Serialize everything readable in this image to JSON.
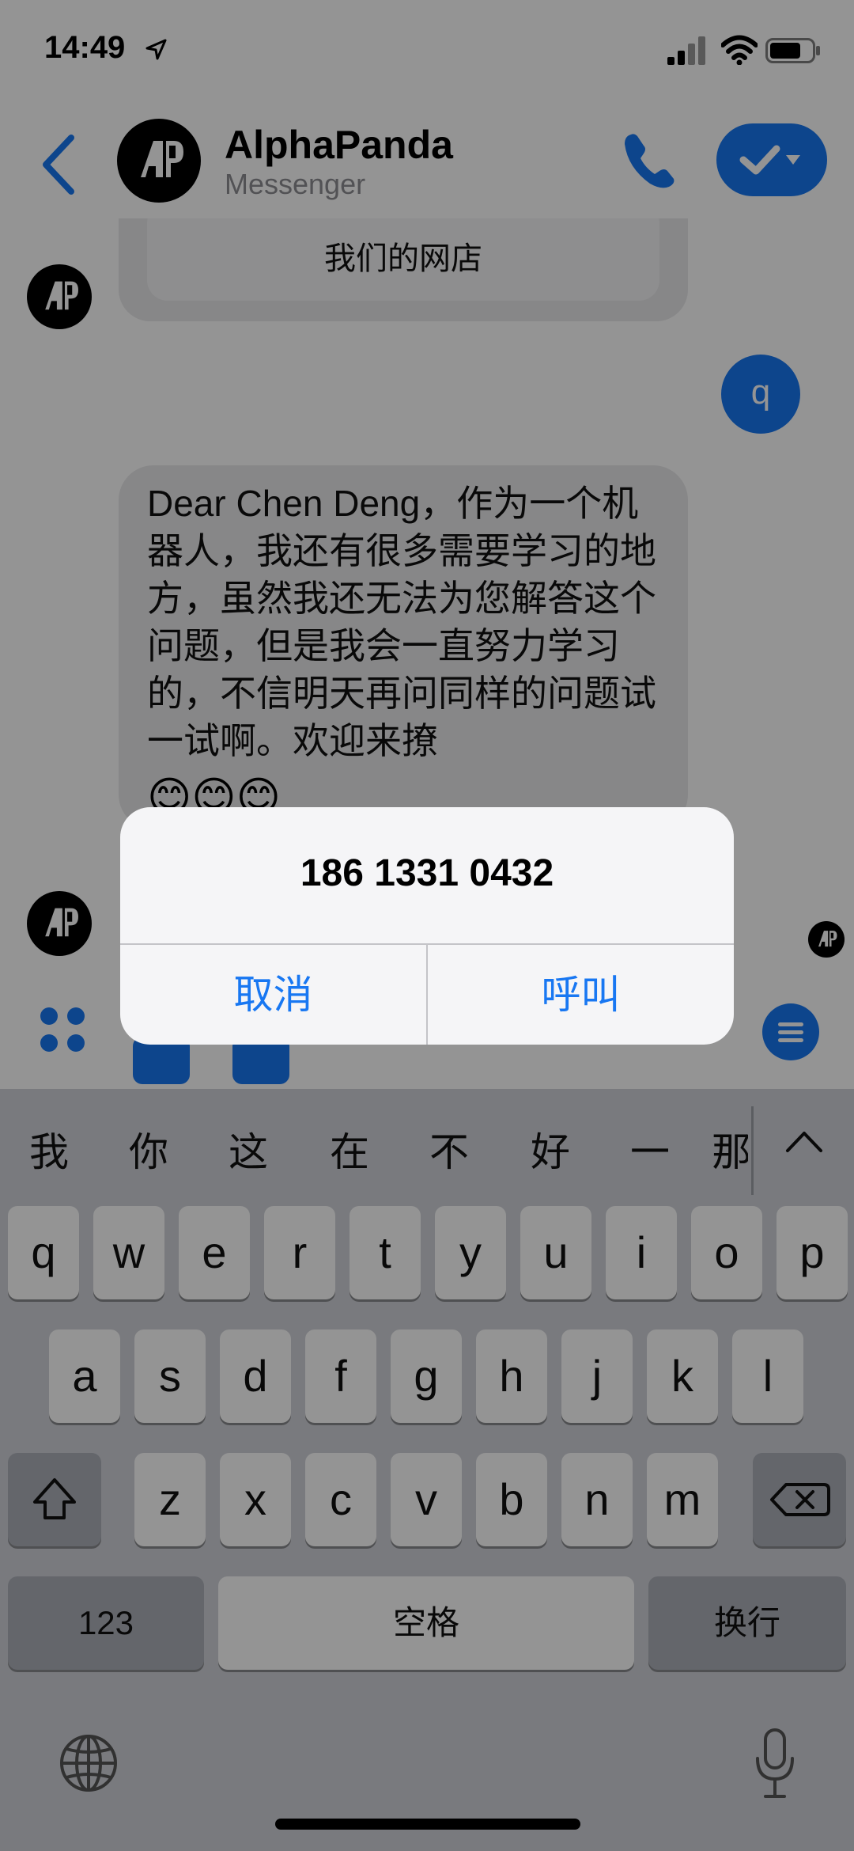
{
  "status_bar": {
    "time": "14:49",
    "battery_level": 0.75
  },
  "header": {
    "title": "AlphaPanda",
    "subtitle": "Messenger"
  },
  "chat": {
    "card_text": "我们的网店",
    "user_message": "q",
    "bot_message": "Dear Chen Deng，作为一个机器人，我还有很多需要学习的地方，虽然我还无法为您解答这个问题，但是我会一直努力学习的，不信明天再问同样的问题试一试啊。欢迎来撩",
    "bot_emoji": "😊😊😊"
  },
  "alert": {
    "title": "186 1331 0432",
    "cancel_label": "取消",
    "call_label": "呼叫"
  },
  "keyboard": {
    "suggestions": [
      "我",
      "你",
      "这",
      "在",
      "不",
      "好",
      "一",
      "那"
    ],
    "row1": [
      "q",
      "w",
      "e",
      "r",
      "t",
      "y",
      "u",
      "i",
      "o",
      "p"
    ],
    "row2": [
      "a",
      "s",
      "d",
      "f",
      "g",
      "h",
      "j",
      "k",
      "l"
    ],
    "row3": [
      "z",
      "x",
      "c",
      "v",
      "b",
      "n",
      "m"
    ],
    "numbers_label": "123",
    "space_label": "空格",
    "return_label": "换行"
  },
  "colors": {
    "accent": "#1877f2",
    "dim_overlay": "rgba(0,0,0,0.42)",
    "keyboard_bg": "#d1d3d9"
  },
  "icons": [
    "location-arrow-icon",
    "signal-icon",
    "wifi-icon",
    "battery-icon",
    "back-chevron-icon",
    "phone-icon",
    "checkmark-icon",
    "four-dots-icon",
    "menu-icon",
    "chevron-up-icon",
    "shift-icon",
    "delete-icon",
    "globe-icon",
    "microphone-icon"
  ]
}
